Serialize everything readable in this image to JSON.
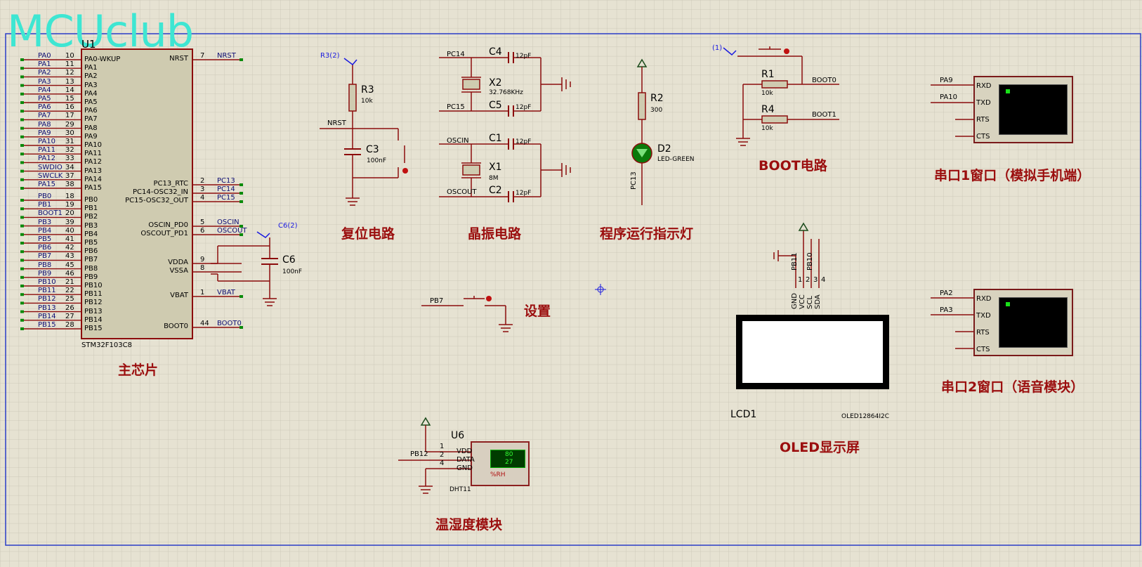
{
  "watermark": "MCUclub",
  "chip": {
    "ref": "U1",
    "part": "STM32F103C8",
    "left_pins": [
      {
        "net": "PA0",
        "num": "10",
        "name": "PA0-WKUP"
      },
      {
        "net": "PA1",
        "num": "11",
        "name": "PA1"
      },
      {
        "net": "PA2",
        "num": "12",
        "name": "PA2"
      },
      {
        "net": "PA3",
        "num": "13",
        "name": "PA3"
      },
      {
        "net": "PA4",
        "num": "14",
        "name": "PA4"
      },
      {
        "net": "PA5",
        "num": "15",
        "name": "PA5"
      },
      {
        "net": "PA6",
        "num": "16",
        "name": "PA6"
      },
      {
        "net": "PA7",
        "num": "17",
        "name": "PA7"
      },
      {
        "net": "PA8",
        "num": "29",
        "name": "PA8"
      },
      {
        "net": "PA9",
        "num": "30",
        "name": "PA9"
      },
      {
        "net": "PA10",
        "num": "31",
        "name": "PA10"
      },
      {
        "net": "PA11",
        "num": "32",
        "name": "PA11"
      },
      {
        "net": "PA12",
        "num": "33",
        "name": "PA12"
      },
      {
        "net": "SWDIO",
        "num": "34",
        "name": "PA13"
      },
      {
        "net": "SWCLK",
        "num": "37",
        "name": "PA14"
      },
      {
        "net": "PA15",
        "num": "38",
        "name": "PA15"
      },
      {
        "net": "PB0",
        "num": "18",
        "name": "PB0"
      },
      {
        "net": "PB1",
        "num": "19",
        "name": "PB1"
      },
      {
        "net": "BOOT1",
        "num": "20",
        "name": "PB2"
      },
      {
        "net": "PB3",
        "num": "39",
        "name": "PB3"
      },
      {
        "net": "PB4",
        "num": "40",
        "name": "PB4"
      },
      {
        "net": "PB5",
        "num": "41",
        "name": "PB5"
      },
      {
        "net": "PB6",
        "num": "42",
        "name": "PB6"
      },
      {
        "net": "PB7",
        "num": "43",
        "name": "PB7"
      },
      {
        "net": "PB8",
        "num": "45",
        "name": "PB8"
      },
      {
        "net": "PB9",
        "num": "46",
        "name": "PB9"
      },
      {
        "net": "PB10",
        "num": "21",
        "name": "PB10"
      },
      {
        "net": "PB11",
        "num": "22",
        "name": "PB11"
      },
      {
        "net": "PB12",
        "num": "25",
        "name": "PB12"
      },
      {
        "net": "PB13",
        "num": "26",
        "name": "PB13"
      },
      {
        "net": "PB14",
        "num": "27",
        "name": "PB14"
      },
      {
        "net": "PB15",
        "num": "28",
        "name": "PB15"
      }
    ],
    "right_pins": [
      {
        "name": "NRST",
        "num": "7",
        "net": "NRST"
      },
      {
        "name": "PC13_RTC",
        "num": "2",
        "net": "PC13"
      },
      {
        "name": "PC14-OSC32_IN",
        "num": "3",
        "net": "PC14"
      },
      {
        "name": "PC15-OSC32_OUT",
        "num": "4",
        "net": "PC15"
      },
      {
        "name": "OSCIN_PD0",
        "num": "5",
        "net": "OSCIN"
      },
      {
        "name": "OSCOUT_PD1",
        "num": "6",
        "net": "OSCOUT"
      },
      {
        "name": "VDDA",
        "num": "9",
        "net": ""
      },
      {
        "name": "VSSA",
        "num": "8",
        "net": ""
      },
      {
        "name": "VBAT",
        "num": "1",
        "net": "VBAT"
      },
      {
        "name": "BOOT0",
        "num": "44",
        "net": "BOOT0"
      }
    ]
  },
  "sections": {
    "main_chip": "主芯片",
    "reset": "复位电路",
    "crystal": "晶振电路",
    "indicator": "程序运行指示灯",
    "boot": "BOOT电路",
    "uart1": "串口1窗口（模拟手机端）",
    "uart2": "串口2窗口（语音模块）",
    "setting": "设置",
    "oled": "OLED显示屏",
    "dht": "温湿度模块"
  },
  "reset": {
    "probe": "R3(2)",
    "r_ref": "R3",
    "r_val": "10k",
    "c_ref": "C3",
    "c_val": "100nF",
    "net": "NRST"
  },
  "c6": {
    "probe": "C6(2)",
    "ref": "C6",
    "val": "100nF"
  },
  "crystal": {
    "c4": "C4",
    "c4v": "12pF",
    "x2": "X2",
    "x2v": "32.768KHz",
    "c5": "C5",
    "c5v": "12pF",
    "c1": "C1",
    "c1v": "12pF",
    "x1": "X1",
    "x1v": "8M",
    "c2": "C2",
    "c2v": "12pF",
    "pc14": "PC14",
    "pc15": "PC15",
    "oscin": "OSCIN",
    "oscout": "OSCOUT"
  },
  "led": {
    "r_ref": "R2",
    "r_val": "300",
    "d_ref": "D2",
    "d_val": "LED-GREEN",
    "net": "PC13"
  },
  "boot": {
    "probe": "(1)",
    "r1": "R1",
    "r1v": "10k",
    "r4": "R4",
    "r4v": "10k",
    "boot0": "BOOT0",
    "boot1": "BOOT1"
  },
  "uart1": {
    "n1": "PA9",
    "n2": "PA10",
    "rxd": "RXD",
    "txd": "TXD",
    "rts": "RTS",
    "cts": "CTS"
  },
  "uart2": {
    "n1": "PA2",
    "n2": "PA3",
    "rxd": "RXD",
    "txd": "TXD",
    "rts": "RTS",
    "cts": "CTS"
  },
  "setting": {
    "net": "PB7"
  },
  "oled": {
    "ref": "LCD1",
    "part": "OLED12864I2C",
    "pins": [
      "GND",
      "VCC",
      "SCL",
      "SDA"
    ],
    "nums": [
      "1",
      "2",
      "3",
      "4"
    ],
    "nets": [
      "PB11",
      "PB10"
    ]
  },
  "dht": {
    "ref": "U6",
    "part": "DHT11",
    "net": "PB12",
    "vdd": "VDD",
    "data": "DATA",
    "gnd": "GND",
    "n1": "1",
    "n2": "2",
    "n4": "4",
    "v1": "80",
    "v2": "27",
    "unit": "%RH"
  },
  "colors": {
    "background": "#e6e2d2",
    "grid": "#c9c5b6",
    "wire": "#8c0c0c",
    "part_body": "#cfcbb0",
    "border": "#2a3cc8"
  }
}
